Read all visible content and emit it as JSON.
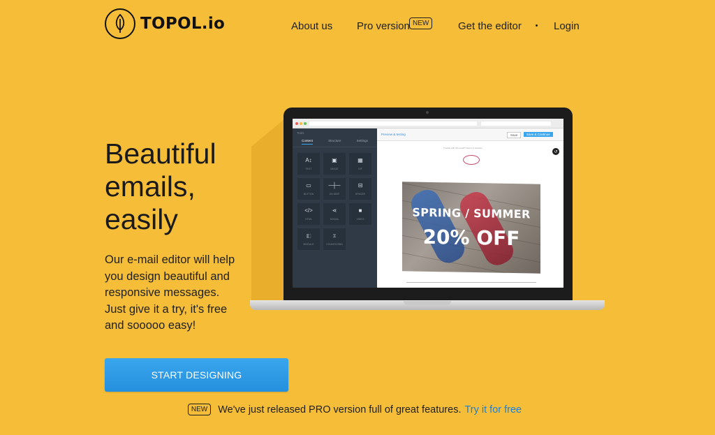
{
  "header": {
    "logo_text": "TOPOL.io",
    "nav": {
      "about": "About us",
      "pro": "Pro version",
      "pro_badge": "NEW",
      "get_editor": "Get the editor",
      "login": "Login"
    }
  },
  "hero": {
    "headline": [
      "Beautiful",
      "emails,",
      "easily"
    ],
    "description": [
      "Our e-mail editor will help",
      "you design beautiful and",
      "responsive messages.",
      "Just give it a try, it's free",
      "and sooooo easy!"
    ],
    "cta_label": "START DESIGNING"
  },
  "release": {
    "badge": "NEW",
    "text": "We've just released PRO version full of great features.",
    "link": "Try it for free"
  },
  "editor_mock": {
    "sidebar_title": "Tools",
    "tabs": [
      "Content",
      "Structure",
      "Settings"
    ],
    "tiles": [
      {
        "icon": "A↕",
        "label": "TEXT"
      },
      {
        "icon": "▣",
        "label": "IMAGE"
      },
      {
        "icon": "▦",
        "label": "GIF"
      },
      {
        "icon": "▭",
        "label": "BUTTON"
      },
      {
        "icon": "─┼─",
        "label": "DIVIDER"
      },
      {
        "icon": "⊟",
        "label": "SPACER"
      },
      {
        "icon": "</>",
        "label": "HTML"
      },
      {
        "icon": "⋖",
        "label": "SOCIAL"
      },
      {
        "icon": "■",
        "label": "VIDEO"
      },
      {
        "icon": "◧",
        "label": "MODULE"
      },
      {
        "icon": "⧗",
        "label": "COUNTDOWN"
      }
    ],
    "preview_label": "Preview & testing",
    "save_label": "Save",
    "save_close_label": "Save & Continue",
    "view_online": "Trouble with this email? View it in browser",
    "promo_line1": "SPRING / SUMMER",
    "promo_line2": "20% OFF"
  },
  "colors": {
    "background": "#F6BE38",
    "button": "#2F9BE8",
    "link": "#1C7FD8"
  },
  "icons": {
    "logo": "leaf-icon"
  }
}
